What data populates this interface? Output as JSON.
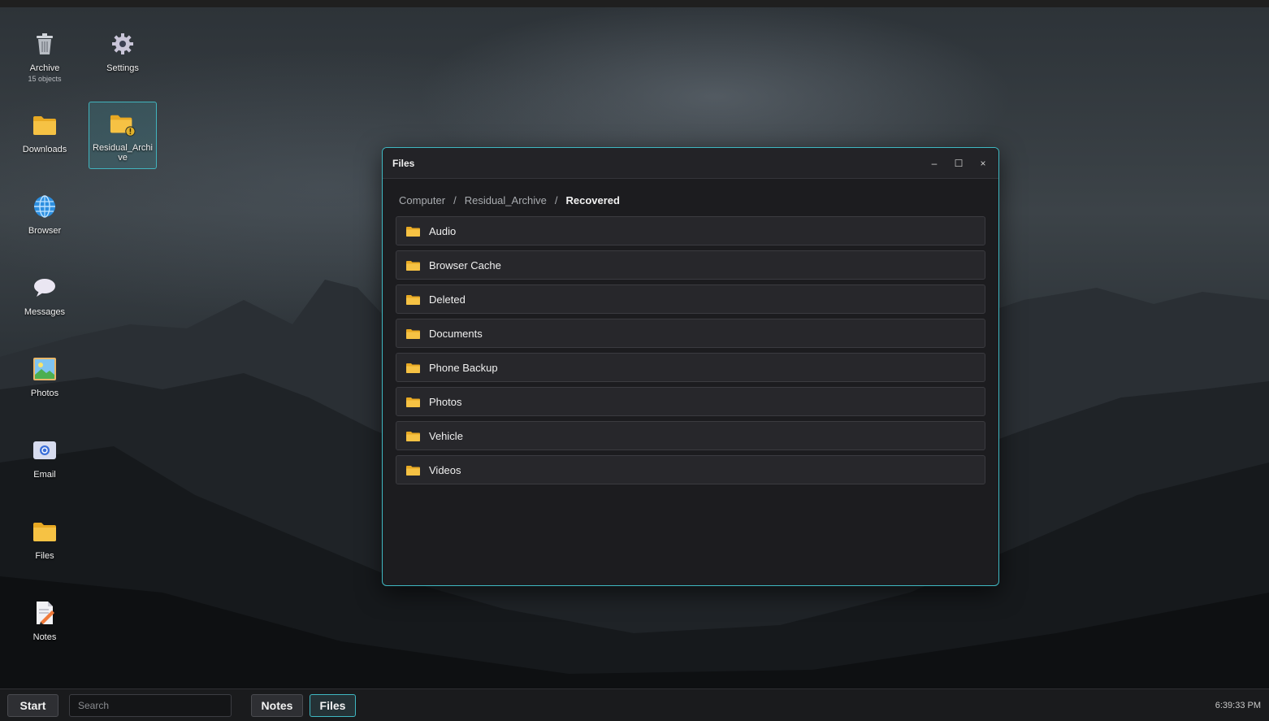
{
  "desktop": {
    "icons": [
      {
        "label": "Archive",
        "sub": "15 objects",
        "icon": "trash-icon"
      },
      {
        "label": "Settings",
        "icon": "gear-icon"
      },
      {
        "label": "Downloads",
        "icon": "folder-icon"
      },
      {
        "label": "Residual_Archive",
        "icon": "folder-warning-icon"
      },
      {
        "label": "Browser",
        "icon": "globe-icon"
      },
      {
        "label": "Messages",
        "icon": "chat-bubble-icon"
      },
      {
        "label": "Photos",
        "icon": "photo-icon"
      },
      {
        "label": "Email",
        "icon": "email-icon"
      },
      {
        "label": "Files",
        "icon": "folder-icon"
      },
      {
        "label": "Notes",
        "icon": "note-pencil-icon"
      }
    ]
  },
  "window": {
    "title": "Files",
    "controls": {
      "minimize": "–",
      "maximize": "☐",
      "close": "×"
    },
    "breadcrumb": [
      "Computer",
      "Residual_Archive",
      "Recovered"
    ],
    "separator": "/",
    "folders": [
      "Audio",
      "Browser Cache",
      "Deleted",
      "Documents",
      "Phone Backup",
      "Photos",
      "Vehicle",
      "Videos"
    ]
  },
  "taskbar": {
    "start_label": "Start",
    "search_placeholder": "Search",
    "apps": [
      {
        "label": "Notes",
        "active": false
      },
      {
        "label": "Files",
        "active": true
      }
    ],
    "clock": "6:39:33 PM"
  },
  "colors": {
    "accent": "#3fb8c2",
    "folder": "#f6c244"
  }
}
